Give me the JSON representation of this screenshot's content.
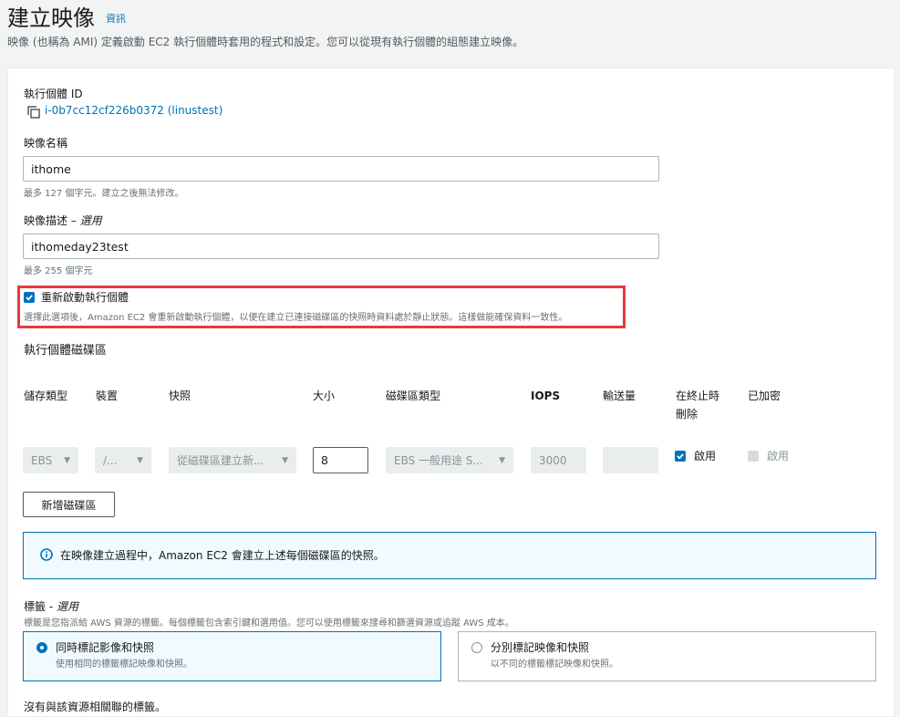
{
  "header": {
    "title": "建立映像",
    "info_link": "資訊",
    "description": "映像 (也稱為 AMI) 定義啟動 EC2 執行個體時套用的程式和設定。您可以從現有執行個體的組態建立映像。"
  },
  "instance": {
    "label": "執行個體 ID",
    "value": "i-0b7cc12cf226b0372 (linustest)"
  },
  "image_name": {
    "label": "映像名稱",
    "value": "ithome",
    "hint": "最多 127 個字元。建立之後無法修改。"
  },
  "image_description": {
    "label": "映像描述 –",
    "optional": "選用",
    "value": "ithomeday23test",
    "hint": "最多 255 個字元"
  },
  "reboot": {
    "label": "重新啟動執行個體",
    "checked": true,
    "description": "選擇此選項後，Amazon EC2 會重新啟動執行個體，以便在建立已連接磁碟區的快照時資料處於靜止狀態。這樣做能確保資料一致性。",
    "highlight_color": "#e33b3b"
  },
  "volumes": {
    "title": "執行個體磁碟區",
    "columns": [
      "儲存類型",
      "裝置",
      "快照",
      "大小",
      "磁碟區類型",
      "IOPS",
      "輸送量",
      "在終止時\n刪除",
      "已加密"
    ],
    "row": {
      "storage_type": "EBS",
      "device": "/...",
      "snapshot": "從磁碟區建立新...",
      "size": "8",
      "volume_type": "EBS 一般用途 S...",
      "iops": "3000",
      "throughput": "",
      "delete_on_termination": "啟用",
      "encrypted": "啟用"
    },
    "add_button": "新增磁碟區"
  },
  "alert": {
    "text": "在映像建立過程中，Amazon EC2 會建立上述每個磁碟區的快照。"
  },
  "tags": {
    "label": "標籤 -",
    "optional": "選用",
    "description": "標籤是您指派給 AWS 資源的標籤。每個標籤包含索引鍵和選用值。您可以使用標籤來搜尋和篩選資源或追蹤 AWS 成本。",
    "options": [
      {
        "title": "同時標記影像和快照",
        "sub": "使用相同的標籤標記映像和快照。",
        "selected": true
      },
      {
        "title": "分別標記映像和快照",
        "sub": "以不同的標籤標記映像和快照。",
        "selected": false
      }
    ],
    "footer": "沒有與該資源相關聯的標籤。"
  },
  "colors": {
    "link": "#0073bb",
    "accent": "#0073bb"
  }
}
